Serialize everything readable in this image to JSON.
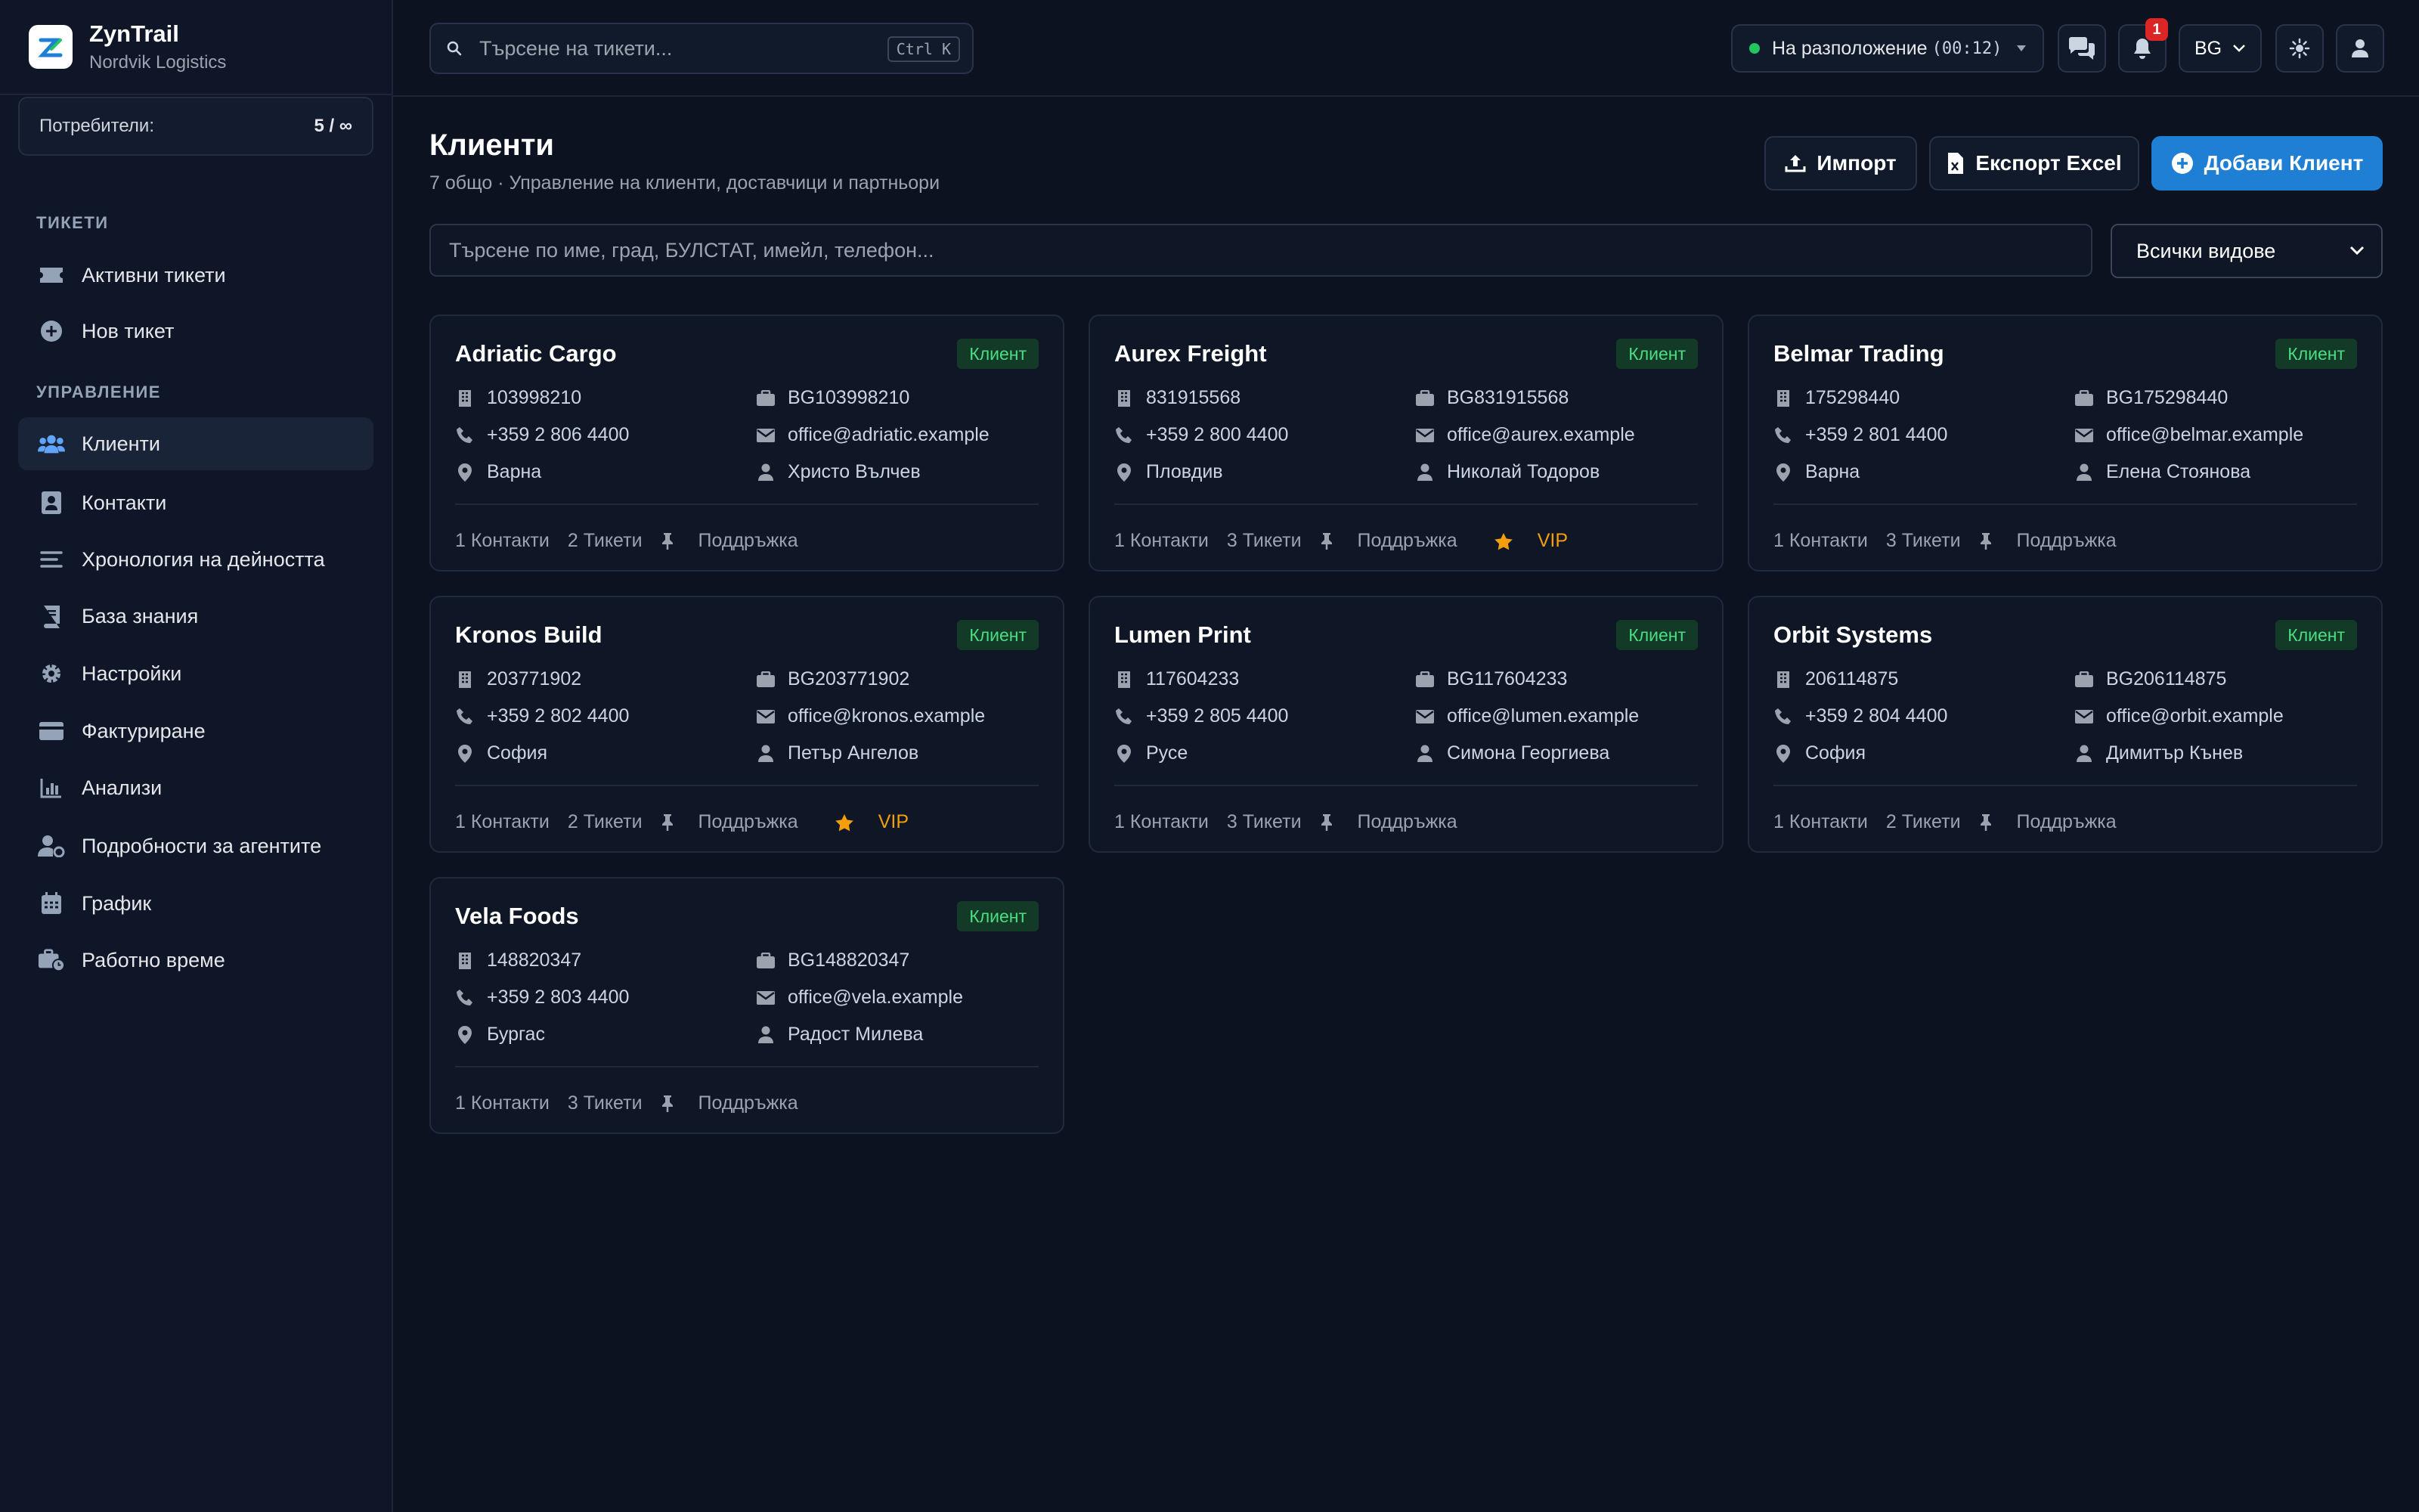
{
  "app": {
    "name": "ZynTrail",
    "org": "Nordvik Logistics"
  },
  "sidebar": {
    "users_label": "Потребители:",
    "users_value": "5 / ∞",
    "section_tickets": "ТИКЕТИ",
    "section_management": "УПРАВЛЕНИЕ",
    "tickets_items": [
      {
        "label": "Активни тикети",
        "icon": "ticket-icon"
      },
      {
        "label": "Нов тикет",
        "icon": "plus-circle-icon"
      }
    ],
    "management_items": [
      {
        "label": "Клиенти",
        "icon": "users-icon",
        "active": true
      },
      {
        "label": "Контакти",
        "icon": "contact-card-icon"
      },
      {
        "label": "Хронология на дейността",
        "icon": "list-icon"
      },
      {
        "label": "База знания",
        "icon": "book-icon"
      },
      {
        "label": "Настройки",
        "icon": "gear-icon"
      },
      {
        "label": "Фактуриране",
        "icon": "credit-card-icon"
      },
      {
        "label": "Анализи",
        "icon": "chart-icon"
      },
      {
        "label": "Подробности за агентите",
        "icon": "user-cog-icon"
      },
      {
        "label": "График",
        "icon": "calendar-icon"
      },
      {
        "label": "Работно време",
        "icon": "briefcase-clock-icon"
      }
    ]
  },
  "topbar": {
    "search_placeholder": "Търсене на тикети...",
    "search_shortcut": "Ctrl K",
    "status_label": "На разположение",
    "status_time": "(00:12)",
    "notification_count": "1",
    "language": "BG"
  },
  "page": {
    "title": "Клиенти",
    "subtitle": "7 общо · Управление на клиенти, доставчици и партньори",
    "import_label": "Импорт",
    "export_label": "Експорт Excel",
    "add_label": "Добави Клиент",
    "filter_placeholder": "Търсене по име, град, БУЛСТАТ, имейл, телефон...",
    "type_select": "Всички видове"
  },
  "clients": [
    {
      "name": "Adriatic Cargo",
      "type": "Клиент",
      "eik": "103998210",
      "vat": "BG103998210",
      "phone": "+359 2 806 4400",
      "email": "office@adriatic.example",
      "city": "Варна",
      "contact": "Христо Вълчев",
      "contacts": "1 Контакти",
      "tickets": "2 Тикети",
      "plan": "Поддръжка",
      "vip": ""
    },
    {
      "name": "Aurex Freight",
      "type": "Клиент",
      "eik": "831915568",
      "vat": "BG831915568",
      "phone": "+359 2 800 4400",
      "email": "office@aurex.example",
      "city": "Пловдив",
      "contact": "Николай Тодоров",
      "contacts": "1 Контакти",
      "tickets": "3 Тикети",
      "plan": "Поддръжка",
      "vip": "VIP"
    },
    {
      "name": "Belmar Trading",
      "type": "Клиент",
      "eik": "175298440",
      "vat": "BG175298440",
      "phone": "+359 2 801 4400",
      "email": "office@belmar.example",
      "city": "Варна",
      "contact": "Елена Стоянова",
      "contacts": "1 Контакти",
      "tickets": "3 Тикети",
      "plan": "Поддръжка",
      "vip": ""
    },
    {
      "name": "Kronos Build",
      "type": "Клиент",
      "eik": "203771902",
      "vat": "BG203771902",
      "phone": "+359 2 802 4400",
      "email": "office@kronos.example",
      "city": "София",
      "contact": "Петър Ангелов",
      "contacts": "1 Контакти",
      "tickets": "2 Тикети",
      "plan": "Поддръжка",
      "vip": "VIP"
    },
    {
      "name": "Lumen Print",
      "type": "Клиент",
      "eik": "117604233",
      "vat": "BG117604233",
      "phone": "+359 2 805 4400",
      "email": "office@lumen.example",
      "city": "Русе",
      "contact": "Симона Георгиева",
      "contacts": "1 Контакти",
      "tickets": "3 Тикети",
      "plan": "Поддръжка",
      "vip": ""
    },
    {
      "name": "Orbit Systems",
      "type": "Клиент",
      "eik": "206114875",
      "vat": "BG206114875",
      "phone": "+359 2 804 4400",
      "email": "office@orbit.example",
      "city": "София",
      "contact": "Димитър Кънев",
      "contacts": "1 Контакти",
      "tickets": "2 Тикети",
      "plan": "Поддръжка",
      "vip": ""
    },
    {
      "name": "Vela Foods",
      "type": "Клиент",
      "eik": "148820347",
      "vat": "BG148820347",
      "phone": "+359 2 803 4400",
      "email": "office@vela.example",
      "city": "Бургас",
      "contact": "Радост Милева",
      "contacts": "1 Контакти",
      "tickets": "3 Тикети",
      "plan": "Поддръжка",
      "vip": ""
    }
  ],
  "colors": {
    "accent": "#1f7fd4",
    "badge_bg": "#123a27",
    "badge_text": "#4ade80",
    "vip": "#f59e0b",
    "status_dot": "#22c55e"
  }
}
